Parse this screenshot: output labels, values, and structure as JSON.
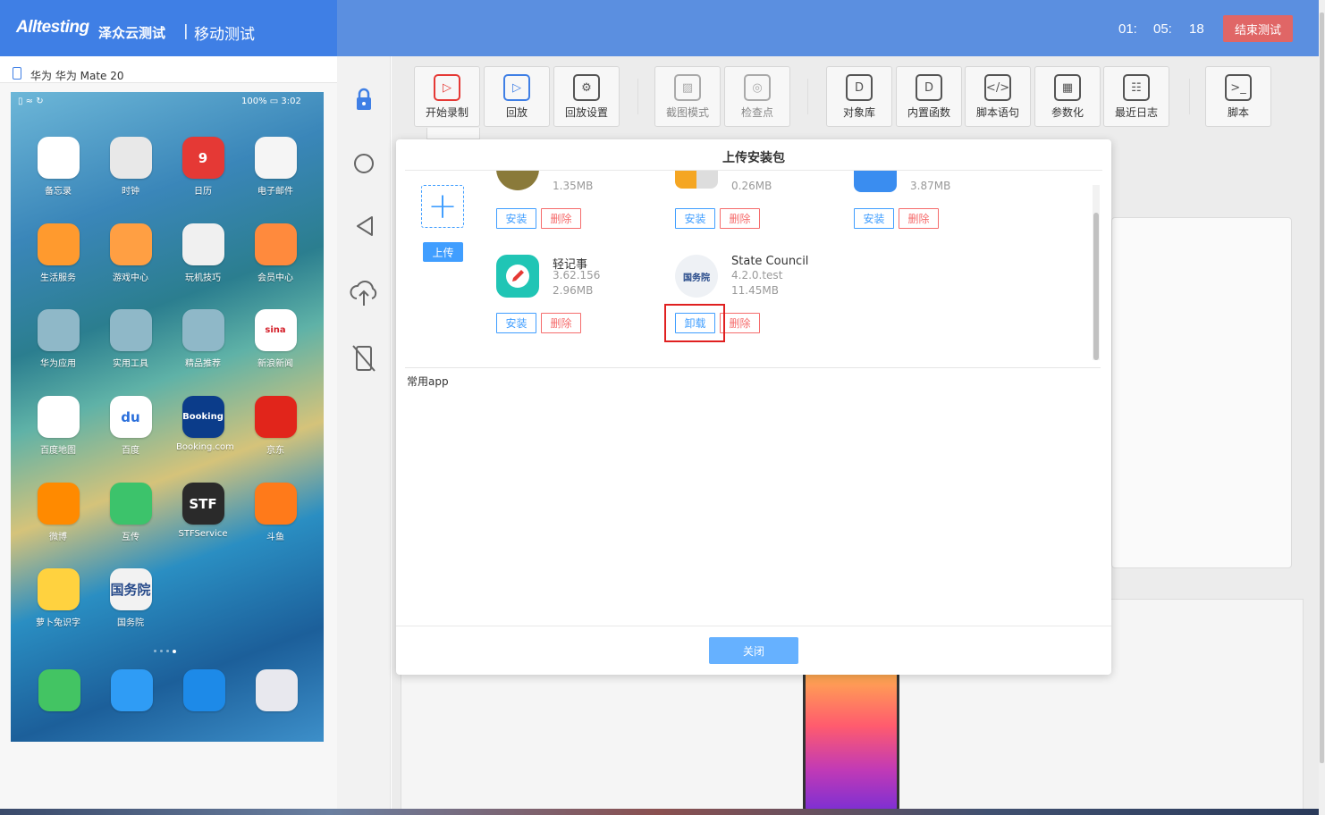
{
  "header": {
    "logo": "Alltesting",
    "brand_cn": "泽众云测试",
    "separator": "|",
    "module": "移动测试",
    "timer": {
      "h": "01:",
      "m": "05:",
      "s": "18"
    },
    "end_button": "结束测试"
  },
  "device": {
    "name": "华为 华为 Mate 20",
    "status_left": "▯ ≈ ↻",
    "status_right": "100% ▭ 3:02",
    "apps": [
      {
        "label": "备忘录",
        "icon": "notes-icon",
        "color": "#ffffff"
      },
      {
        "label": "时钟",
        "icon": "clock-icon",
        "color": "#e8e8e8"
      },
      {
        "label": "日历",
        "icon": "calendar-icon",
        "color": "#e53935",
        "text": "9"
      },
      {
        "label": "电子邮件",
        "icon": "mail-icon",
        "color": "#f5f5f5"
      },
      {
        "label": "生活服务",
        "icon": "cup-icon",
        "color": "#ff9a2e"
      },
      {
        "label": "游戏中心",
        "icon": "gamepad-icon",
        "color": "#ff9f43"
      },
      {
        "label": "玩机技巧",
        "icon": "tips-icon",
        "color": "#f0f0f0"
      },
      {
        "label": "会员中心",
        "icon": "diamond-icon",
        "color": "#ff8a3d"
      },
      {
        "label": "华为应用",
        "icon": "folder-icon",
        "color": "#8fb8c8"
      },
      {
        "label": "实用工具",
        "icon": "folder-icon",
        "color": "#8fb8c8"
      },
      {
        "label": "精品推荐",
        "icon": "folder-icon",
        "color": "#8fb8c8"
      },
      {
        "label": "新浪新闻",
        "icon": "sina-icon",
        "color": "#ffffff",
        "text": "sina"
      },
      {
        "label": "百度地图",
        "icon": "map-pin-icon",
        "color": "#ffffff"
      },
      {
        "label": "百度",
        "icon": "baidu-paw-icon",
        "color": "#ffffff",
        "text": "du"
      },
      {
        "label": "Booking.com",
        "icon": "booking-icon",
        "color": "#0b3c8a",
        "text": "Booking"
      },
      {
        "label": "京东",
        "icon": "jd-icon",
        "color": "#e1251b"
      },
      {
        "label": "微博",
        "icon": "weibo-icon",
        "color": "#ff8a00"
      },
      {
        "label": "互传",
        "icon": "share-arrows-icon",
        "color": "#3cc36b"
      },
      {
        "label": "STFService",
        "icon": "stf-icon",
        "color": "#2a2a2a",
        "text": "STF"
      },
      {
        "label": "斗鱼",
        "icon": "douyu-icon",
        "color": "#ff7a1a"
      },
      {
        "label": "萝卜兔识字",
        "icon": "rabbit-icon",
        "color": "#ffd23f"
      },
      {
        "label": "国务院",
        "icon": "gov-icon",
        "color": "#f2f2f2",
        "text": "国务院"
      }
    ],
    "dock": [
      {
        "icon": "phone-icon",
        "color": "#43c463"
      },
      {
        "icon": "message-icon",
        "color": "#2f9cf5"
      },
      {
        "icon": "browser-icon",
        "color": "#1d8ae8"
      },
      {
        "icon": "camera-icon",
        "color": "#e8e8ee"
      }
    ]
  },
  "toolbar": [
    {
      "label": "开始录制",
      "icon": "record-icon",
      "glyph": "▷",
      "disabled": false
    },
    {
      "label": "回放",
      "icon": "playback-icon",
      "glyph": "▷",
      "disabled": false
    },
    {
      "label": "回放设置",
      "icon": "gear-icon",
      "glyph": "⚙",
      "disabled": false
    },
    {
      "label": "截图模式",
      "icon": "screenshot-icon",
      "glyph": "▨",
      "disabled": true
    },
    {
      "label": "检查点",
      "icon": "checkpoint-icon",
      "glyph": "◎",
      "disabled": true
    },
    {
      "label": "对象库",
      "icon": "object-lib-icon",
      "glyph": "D",
      "disabled": false
    },
    {
      "label": "内置函数",
      "icon": "builtin-func-icon",
      "glyph": "D",
      "disabled": false
    },
    {
      "label": "脚本语句",
      "icon": "script-statement-icon",
      "glyph": "</>",
      "disabled": false
    },
    {
      "label": "参数化",
      "icon": "parameterize-icon",
      "glyph": "▦",
      "disabled": false
    },
    {
      "label": "最近日志",
      "icon": "log-icon",
      "glyph": "☷",
      "disabled": false
    },
    {
      "label": "脚本",
      "icon": "terminal-icon",
      "glyph": ">_",
      "disabled": false
    }
  ],
  "modal": {
    "title": "上传安装包",
    "upload_plus": "+",
    "upload_label": "上传",
    "top_row": [
      {
        "size": "1.35MB",
        "install": "安装",
        "delete": "删除",
        "color": "#8a7a3a"
      },
      {
        "size": "0.26MB",
        "install": "安装",
        "delete": "删除",
        "color": "#f5a623"
      },
      {
        "size": "3.87MB",
        "install": "安装",
        "delete": "删除",
        "color": "#3a8df0"
      }
    ],
    "packages": [
      {
        "name": "轻记事",
        "version": "3.62.156",
        "size": "2.96MB",
        "action": "安装",
        "delete": "删除",
        "icon": "notepad-pencil-icon"
      },
      {
        "name": "State Council",
        "version": "4.2.0.test",
        "size": "11.45MB",
        "action": "卸载",
        "delete": "删除",
        "icon": "state-council-icon",
        "icon_text": "国务院"
      }
    ],
    "section_label": "常用app",
    "close_label": "关闭"
  }
}
